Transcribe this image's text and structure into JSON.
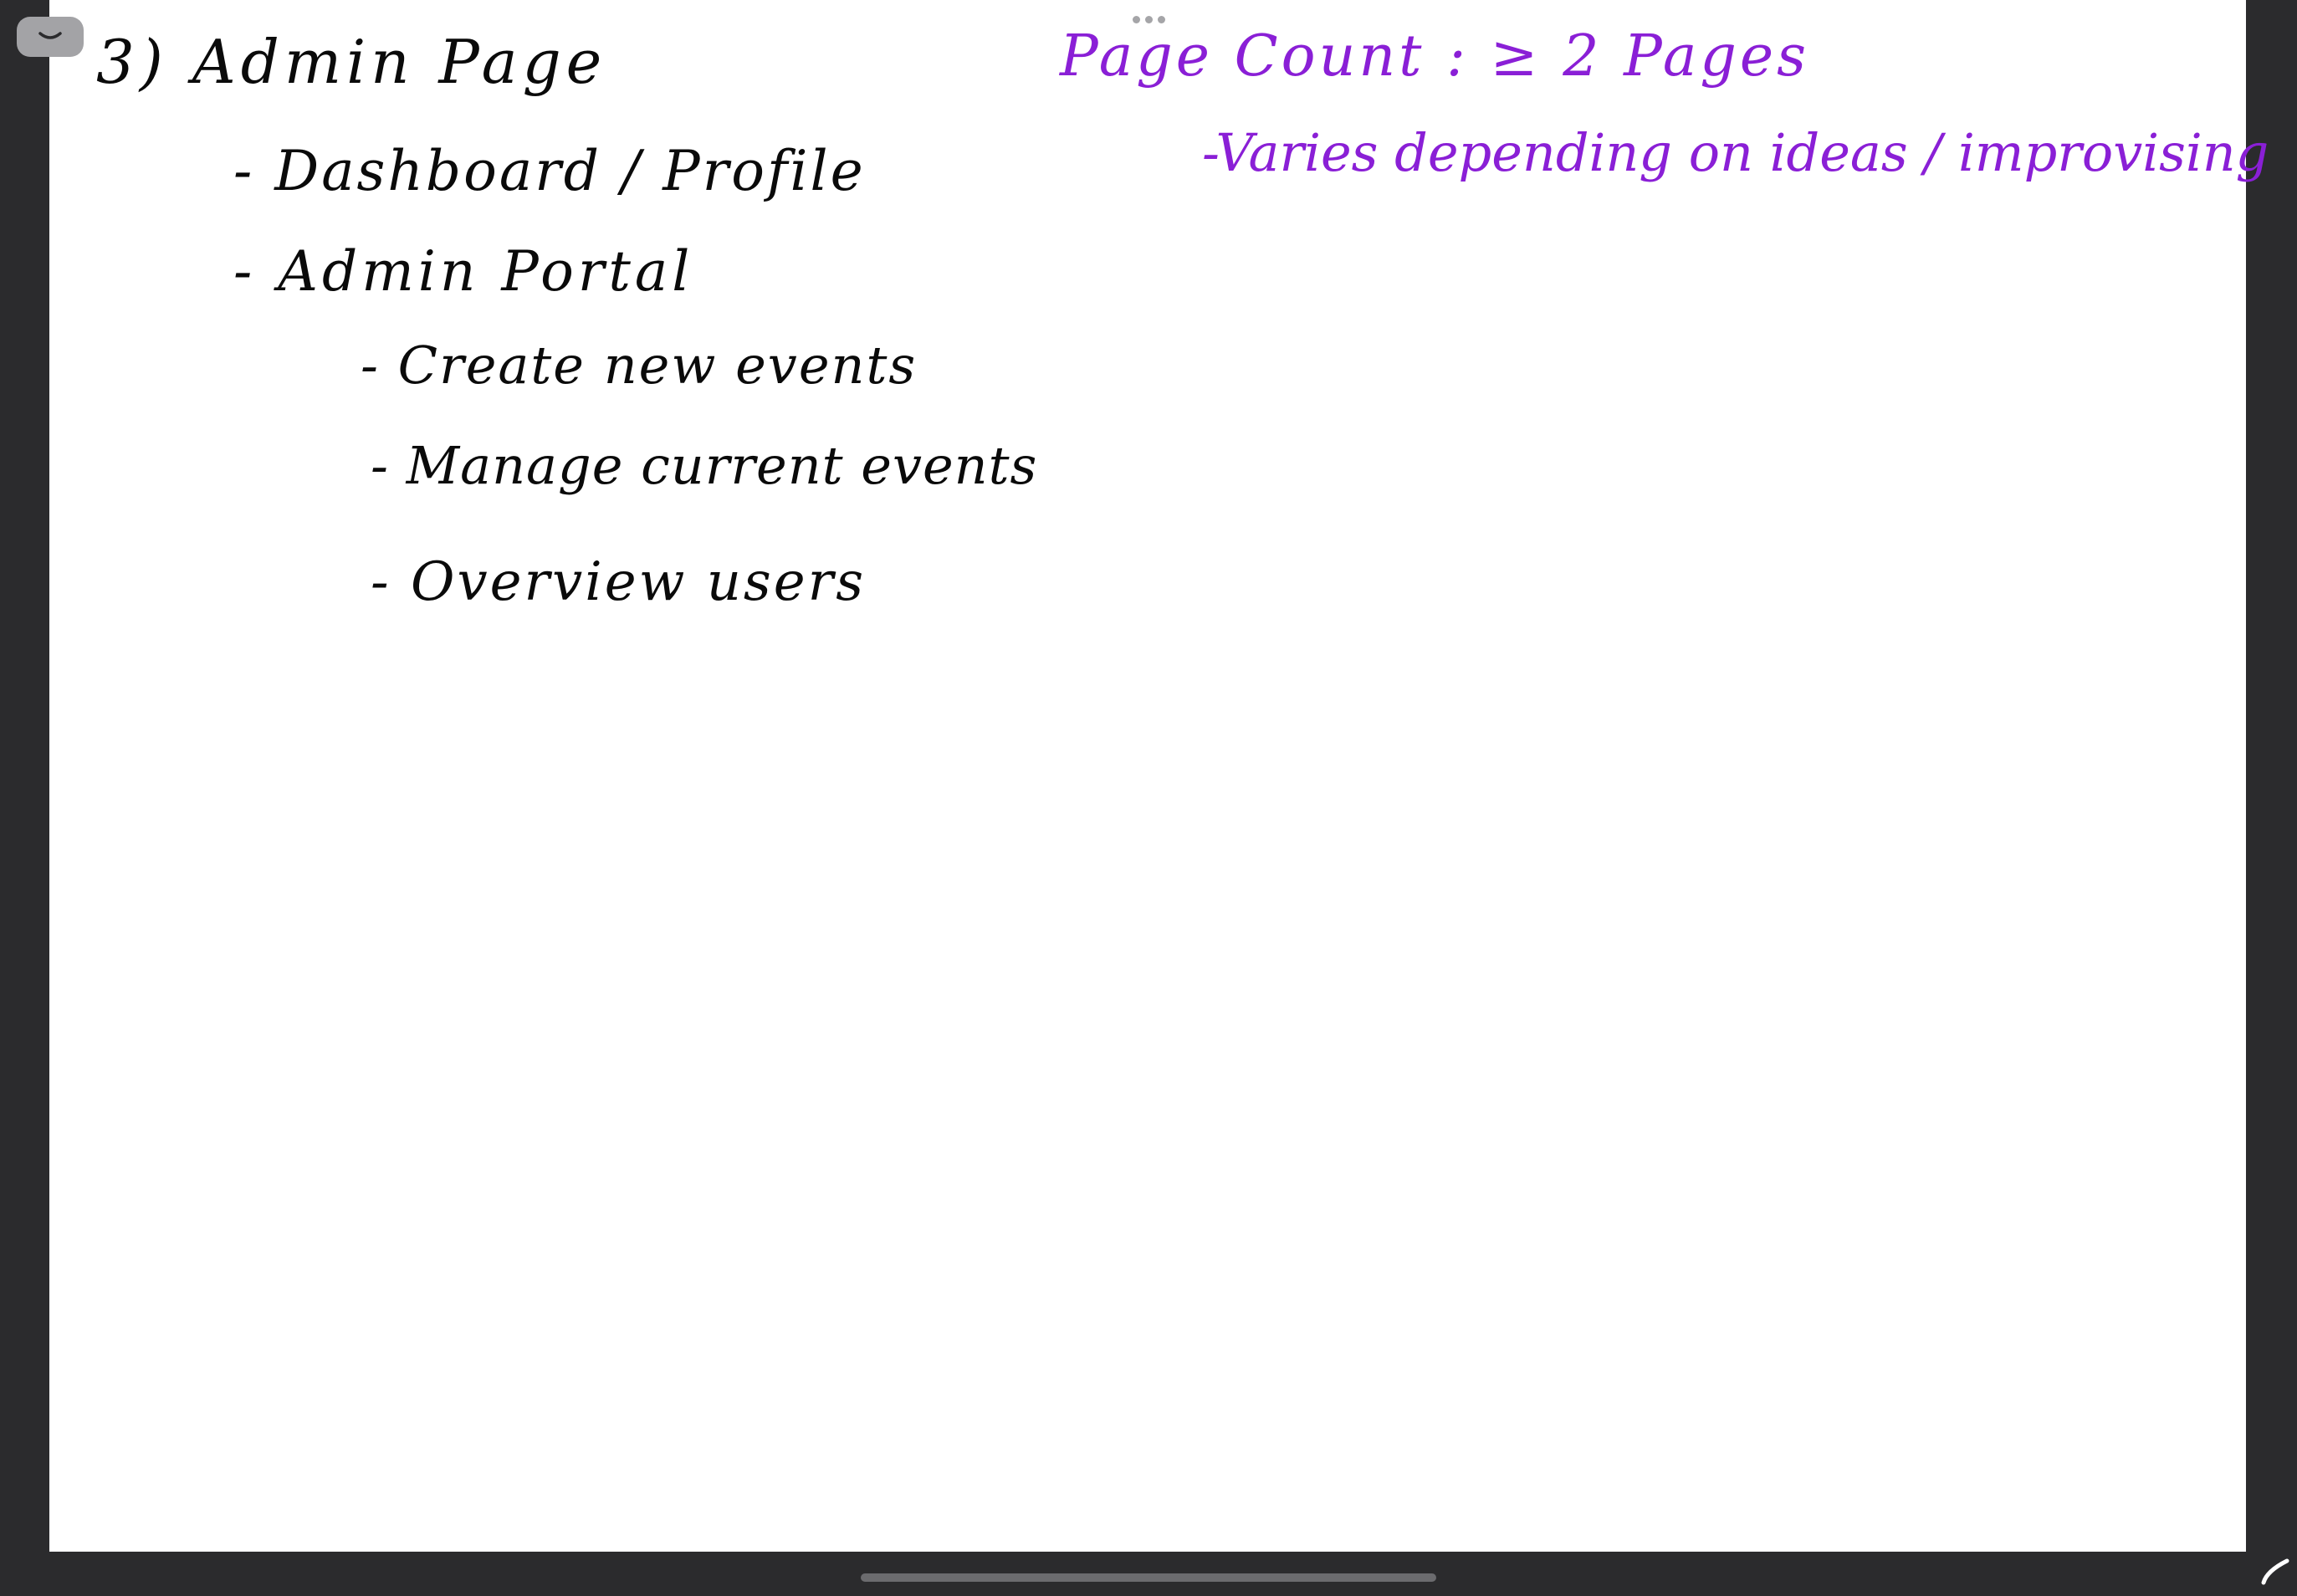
{
  "toolbar": {
    "collapse_icon": "chevron-down-icon",
    "more_icon": "ellipsis-icon"
  },
  "notes": {
    "heading": "3) Admin Page",
    "items": [
      "- Dashboard / Profile",
      "- Admin Portal"
    ],
    "subitems": [
      "- Create new events",
      "- Manage current events",
      "- Overview users"
    ],
    "side_note": {
      "title": "Page Count : ≥ 2 Pages",
      "detail": "-Varies depending on ideas / improvising"
    }
  },
  "colors": {
    "black_ink": "#0a0a0a",
    "purple_ink": "#8a1fd6",
    "background_dark": "#2b2b2d",
    "canvas": "#ffffff"
  },
  "footer": {
    "pencil_icon": "pencil-tool-icon"
  }
}
